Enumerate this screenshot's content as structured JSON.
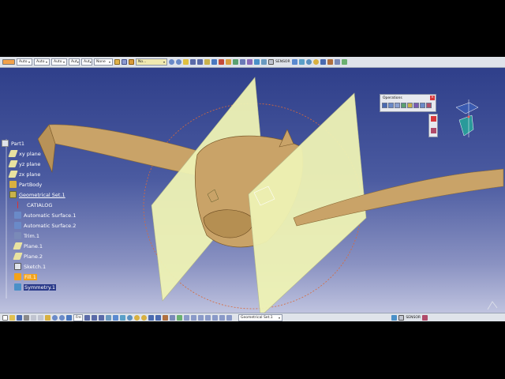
{
  "toolbar_top": {
    "combos": [
      "Auto",
      "Auto",
      "Auto",
      "Aut",
      "Aut",
      "None"
    ],
    "layer_combo": "No...",
    "sensor_label": "SENSOR"
  },
  "operations_panel": {
    "title": "Operations"
  },
  "tree": {
    "items": [
      {
        "label": "Part1"
      },
      {
        "label": "xy plane"
      },
      {
        "label": "yz plane"
      },
      {
        "label": "zx plane"
      },
      {
        "label": "PartBody"
      },
      {
        "label": "Geometrical Set.1"
      },
      {
        "label": "CATIALOG"
      },
      {
        "label": "Automatic Surface.1"
      },
      {
        "label": "Automatic Surface.2"
      },
      {
        "label": "Trim.1"
      },
      {
        "label": "Plane.1"
      },
      {
        "label": "Plane.2"
      },
      {
        "label": "Sketch.1"
      },
      {
        "label": "Fill.1"
      },
      {
        "label": "Symmetry.1"
      }
    ]
  },
  "toolbar_bottom": {
    "zoom_combo": "Fre",
    "geometrical_set_combo": "Geometrical Set.1",
    "sensor_label": "SENSOR"
  },
  "colors": {
    "model": "#c9a368",
    "planes": "#eef2b4",
    "background_top": "#2f3f8a",
    "background_bottom": "#bfc3df",
    "highlight": "#f3a21a"
  }
}
